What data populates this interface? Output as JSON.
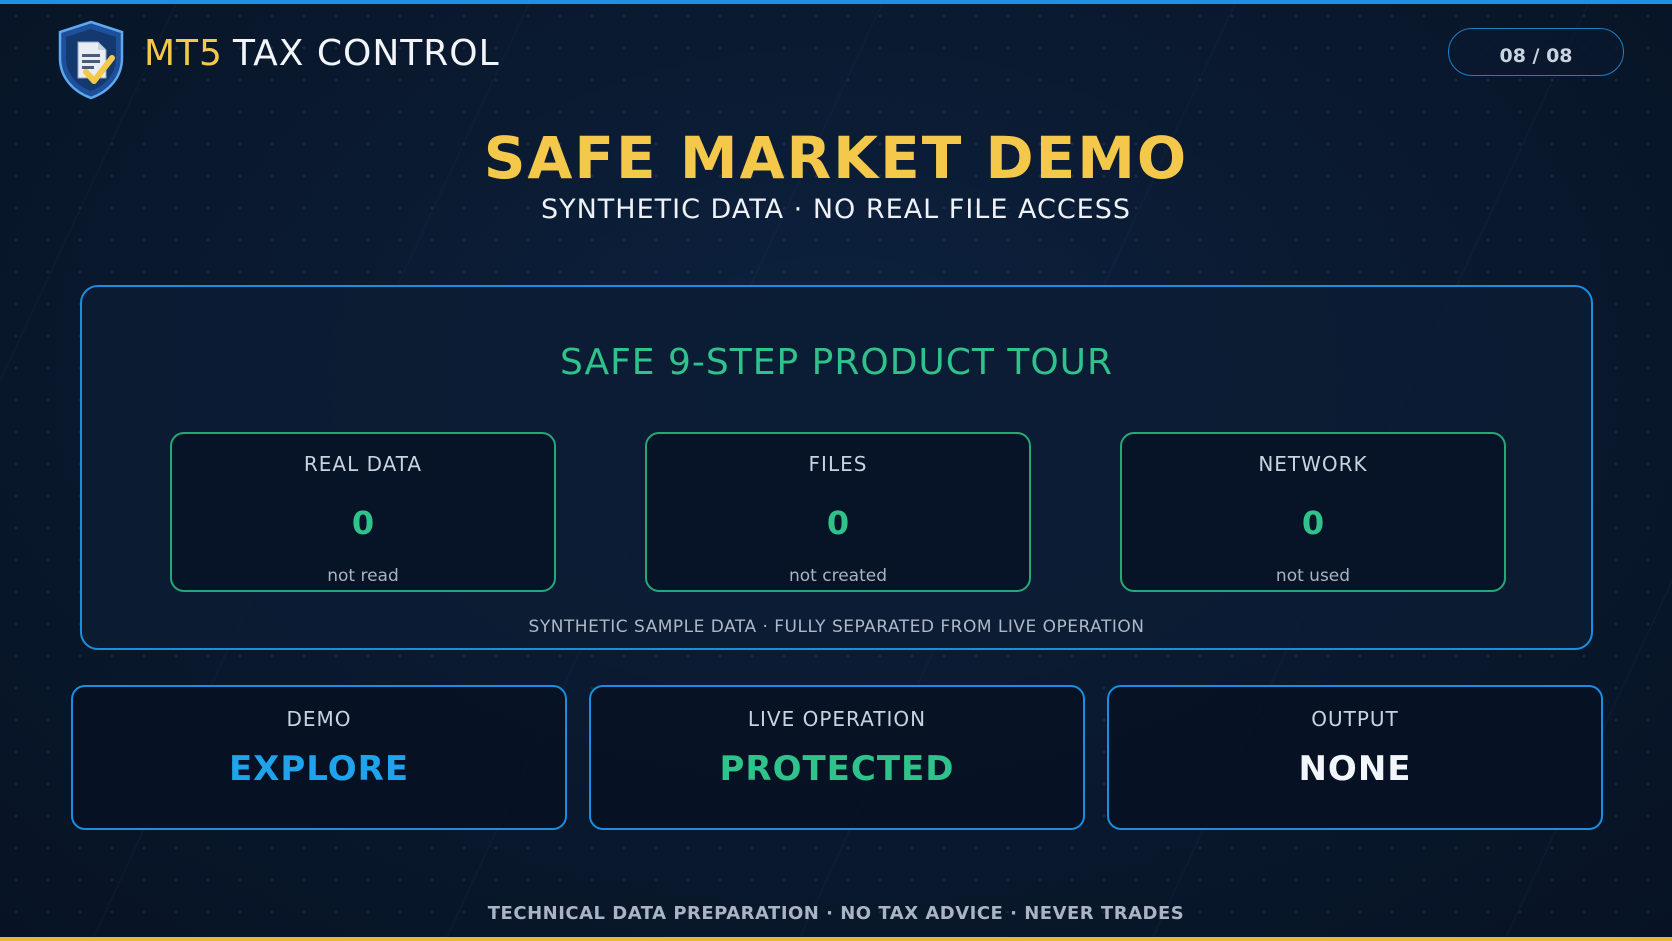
{
  "brand": {
    "accent": "MT5",
    "rest": "TAX CONTROL",
    "logo_icon": "shield-document-check-icon"
  },
  "page_indicator": "08 / 08",
  "title": "SAFE MARKET DEMO",
  "subtitle": "SYNTHETIC DATA · NO REAL FILE ACCESS",
  "tour": {
    "title": "SAFE 9-STEP PRODUCT TOUR",
    "metrics": [
      {
        "label": "REAL DATA",
        "value": "0",
        "note": "not read"
      },
      {
        "label": "FILES",
        "value": "0",
        "note": "not created"
      },
      {
        "label": "NETWORK",
        "value": "0",
        "note": "not used"
      }
    ],
    "footer": "SYNTHETIC SAMPLE DATA · FULLY SEPARATED FROM LIVE OPERATION"
  },
  "status": [
    {
      "label": "DEMO",
      "value": "EXPLORE",
      "color": "#1fa3ec"
    },
    {
      "label": "LIVE OPERATION",
      "value": "PROTECTED",
      "color": "#2fc28a"
    },
    {
      "label": "OUTPUT",
      "value": "NONE",
      "color": "#f2f5fa"
    }
  ],
  "footer": "TECHNICAL DATA PREPARATION · NO TAX ADVICE · NEVER TRADES",
  "colors": {
    "accent_gold": "#f4c84a",
    "accent_green": "#2fc28a",
    "accent_blue": "#1a8ee0",
    "background": "#0a1a30"
  }
}
